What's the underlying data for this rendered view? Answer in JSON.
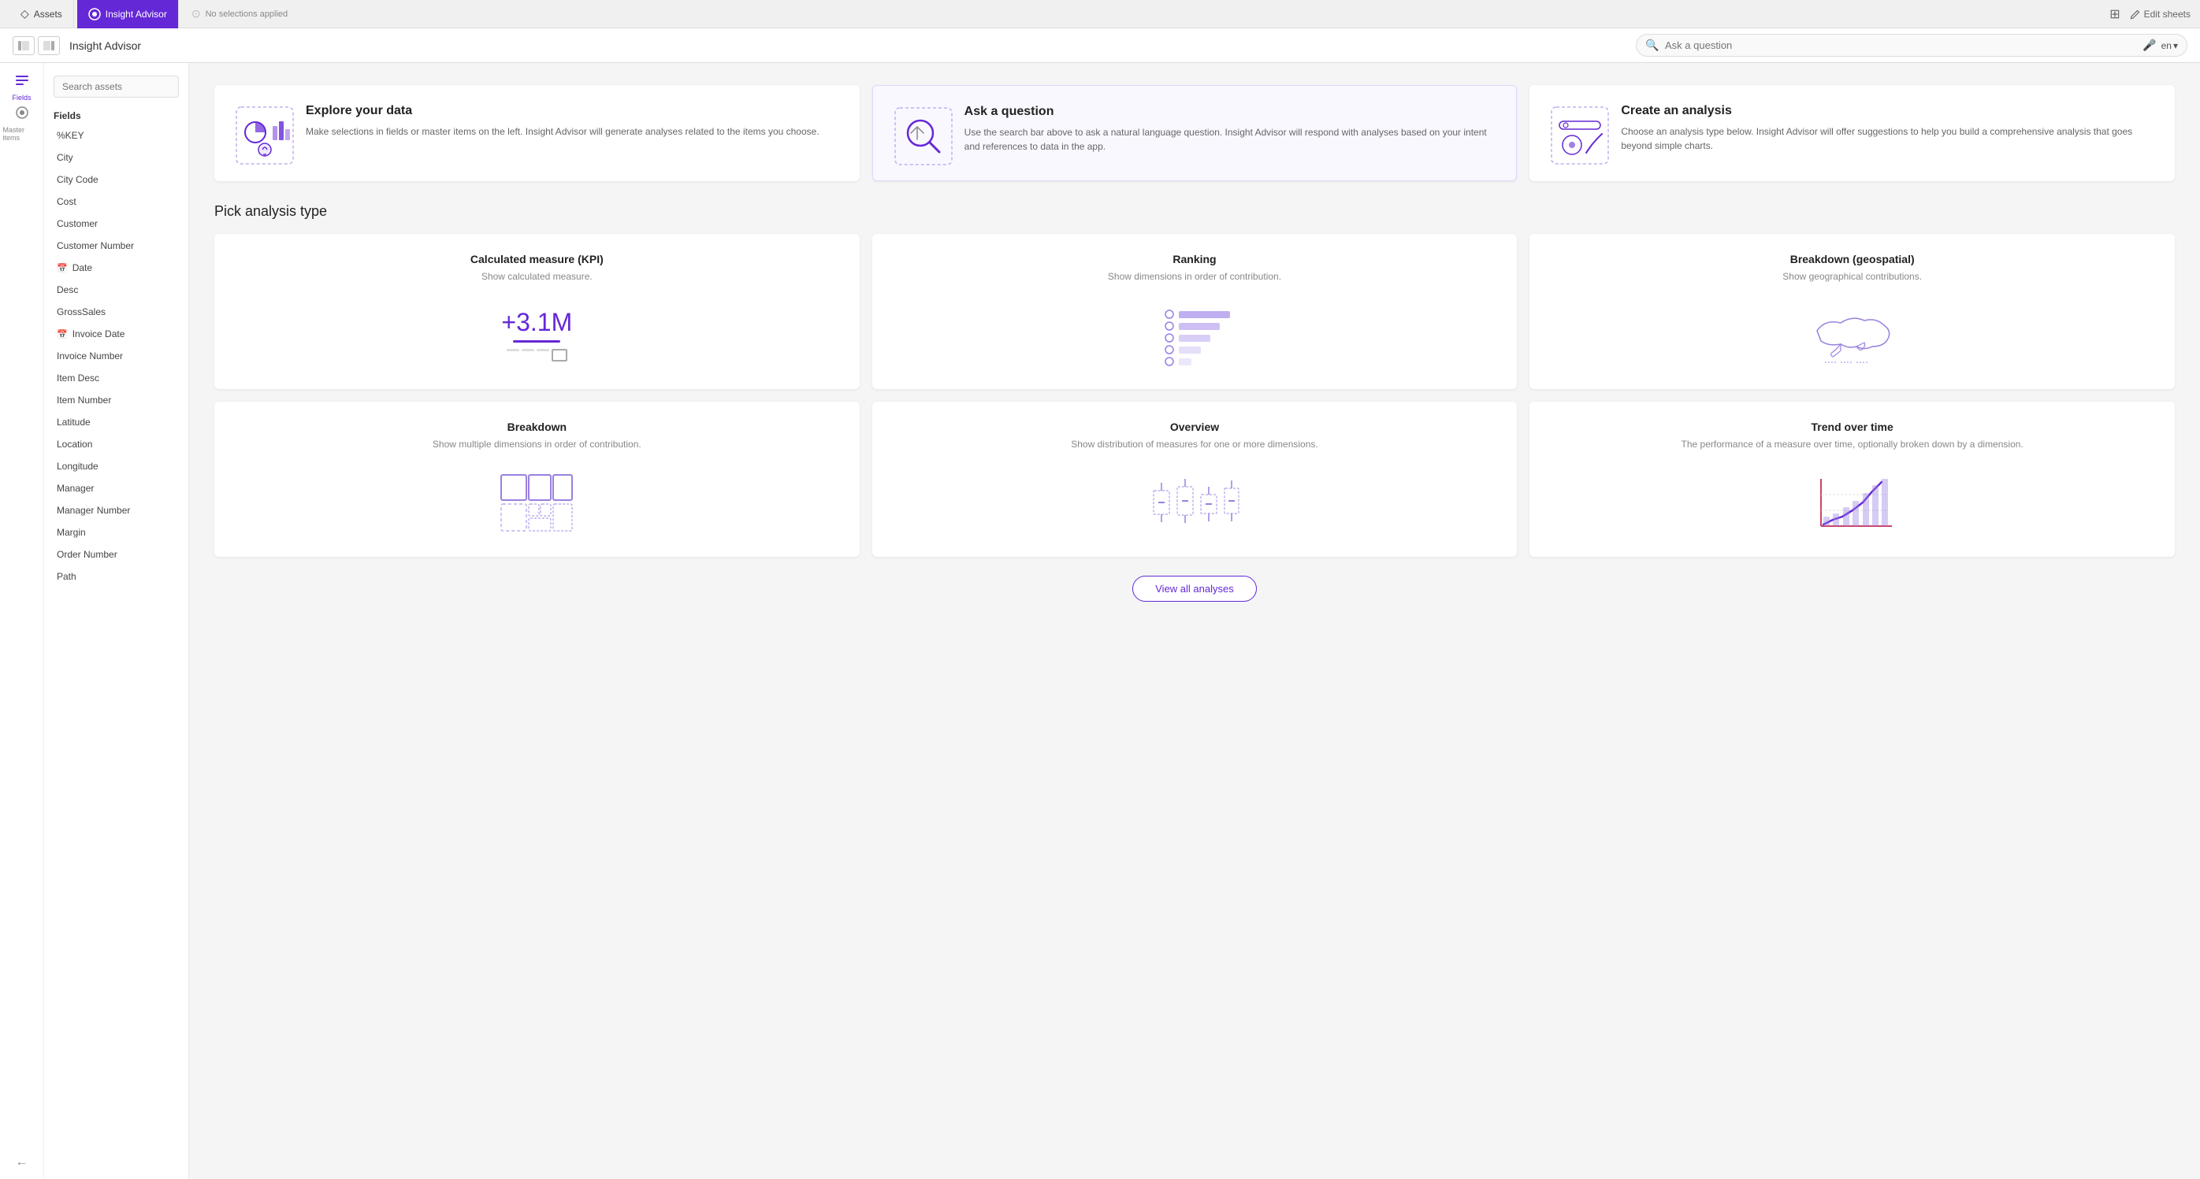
{
  "topNav": {
    "assetsTab": "Assets",
    "insightAdvisorTab": "Insight Advisor",
    "noSelections": "No selections applied",
    "editSheets": "Edit sheets"
  },
  "secondBar": {
    "title": "Insight Advisor",
    "searchPlaceholder": "Ask a question",
    "lang": "en"
  },
  "sidebar": {
    "searchPlaceholder": "Search assets",
    "fieldsLabel": "Fields",
    "masterItemsLabel": "Master items",
    "fields": [
      {
        "name": "%KEY",
        "icon": ""
      },
      {
        "name": "City",
        "icon": ""
      },
      {
        "name": "City Code",
        "icon": ""
      },
      {
        "name": "Cost",
        "icon": ""
      },
      {
        "name": "Customer",
        "icon": ""
      },
      {
        "name": "Customer Number",
        "icon": ""
      },
      {
        "name": "Date",
        "icon": "calendar"
      },
      {
        "name": "Desc",
        "icon": ""
      },
      {
        "name": "GrossSales",
        "icon": ""
      },
      {
        "name": "Invoice Date",
        "icon": "calendar"
      },
      {
        "name": "Invoice Number",
        "icon": ""
      },
      {
        "name": "Item Desc",
        "icon": ""
      },
      {
        "name": "Item Number",
        "icon": ""
      },
      {
        "name": "Latitude",
        "icon": ""
      },
      {
        "name": "Location",
        "icon": ""
      },
      {
        "name": "Longitude",
        "icon": ""
      },
      {
        "name": "Manager",
        "icon": ""
      },
      {
        "name": "Manager Number",
        "icon": ""
      },
      {
        "name": "Margin",
        "icon": ""
      },
      {
        "name": "Order Number",
        "icon": ""
      },
      {
        "name": "Path",
        "icon": ""
      }
    ]
  },
  "infoCards": [
    {
      "id": "explore",
      "title": "Explore your data",
      "description": "Make selections in fields or master items on the left. Insight Advisor will generate analyses related to the items you choose."
    },
    {
      "id": "ask",
      "title": "Ask a question",
      "description": "Use the search bar above to ask a natural language question. Insight Advisor will respond with analyses based on your intent and references to data in the app."
    },
    {
      "id": "create",
      "title": "Create an analysis",
      "description": "Choose an analysis type below. Insight Advisor will offer suggestions to help you build a comprehensive analysis that goes beyond simple charts."
    }
  ],
  "analysisSection": {
    "title": "Pick analysis type",
    "viewAllBtn": "View all analyses",
    "cards": [
      {
        "id": "kpi",
        "title": "Calculated measure (KPI)",
        "description": "Show calculated measure.",
        "visualType": "kpi"
      },
      {
        "id": "ranking",
        "title": "Ranking",
        "description": "Show dimensions in order of contribution.",
        "visualType": "ranking"
      },
      {
        "id": "geospatial",
        "title": "Breakdown (geospatial)",
        "description": "Show geographical contributions.",
        "visualType": "geo"
      },
      {
        "id": "breakdown",
        "title": "Breakdown",
        "description": "Show multiple dimensions in order of contribution.",
        "visualType": "breakdown"
      },
      {
        "id": "overview",
        "title": "Overview",
        "description": "Show distribution of measures for one or more dimensions.",
        "visualType": "overview"
      },
      {
        "id": "trend",
        "title": "Trend over time",
        "description": "The performance of a measure over time, optionally broken down by a dimension.",
        "visualType": "trend"
      }
    ]
  },
  "colors": {
    "brand": "#6528d7",
    "brandLight": "#e8deff",
    "text": "#222222",
    "muted": "#888888"
  }
}
